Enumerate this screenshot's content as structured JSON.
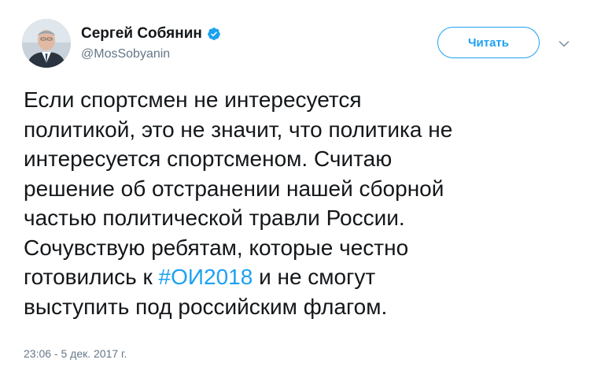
{
  "author": {
    "display_name": "Сергей Собянин",
    "handle": "@MosSobyanin",
    "verified": true
  },
  "follow_button": {
    "label": "Читать"
  },
  "tweet": {
    "lines": [
      {
        "before": "Если спортсмен не интересуется"
      },
      {
        "before": "политикой, это не значит, что политика не"
      },
      {
        "before": "интересуется спортсменом. Считаю"
      },
      {
        "before": "решение об отстранении нашей сборной"
      },
      {
        "before": "частью политической травли России."
      },
      {
        "before": "Сочувствую ребятам, которые честно"
      },
      {
        "before": "готовились к ",
        "hashtag": "#ОИ2018",
        "after": " и не смогут"
      },
      {
        "before": "выступить под российским флагом."
      }
    ],
    "timestamp": "23:06 - 5 дек. 2017 г."
  },
  "colors": {
    "accent": "#1da1f2",
    "text": "#14171a",
    "muted": "#657786"
  },
  "icons": {
    "verified": "verified-badge-icon",
    "menu": "chevron-down-icon"
  }
}
